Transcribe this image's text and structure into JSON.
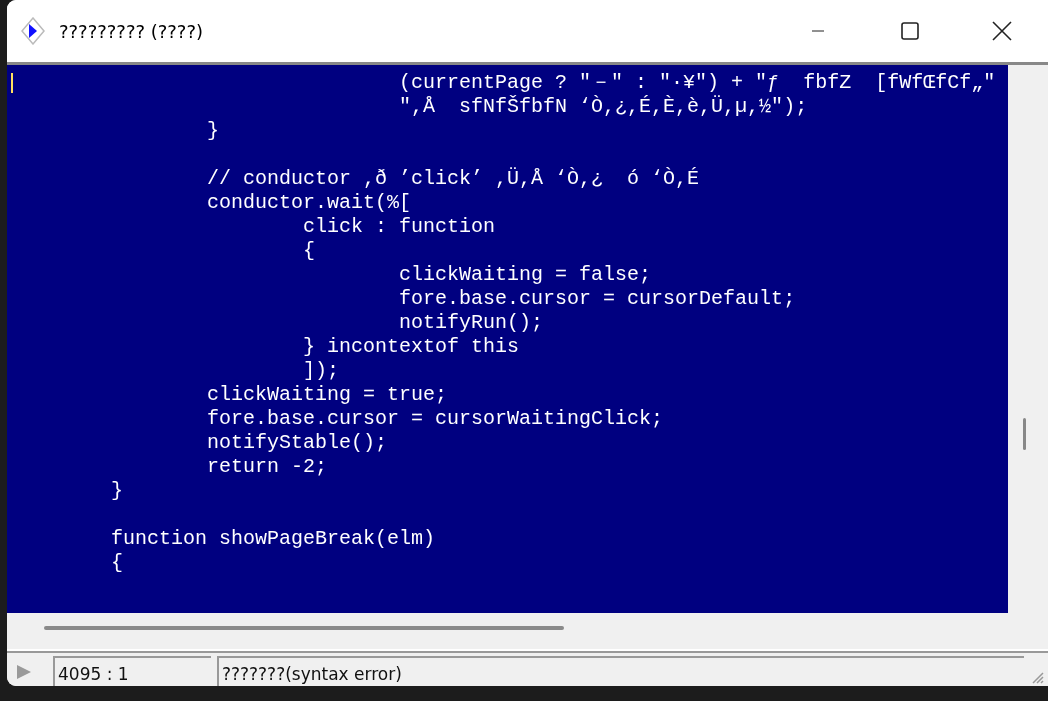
{
  "window": {
    "title": "????????? (????)"
  },
  "editor": {
    "lines": [
      {
        "text": "\t\t\t\t(currentPage ? \"－\" : \"·¥\") + \"ƒ  fbfZ  [fWfŒfCf„\"",
        "blank_before": false
      },
      {
        "text": "\t\t\t\t\",Å  sfNfŠfbfN ‘Ò,¿,É,È,è,Ü,µ,½\");",
        "blank_before": false
      },
      {
        "text": "\t\t}",
        "blank_before": false
      },
      {
        "text": "\t\t// conductor ,ð ’click’ ,Ü,Å ‘Ò,¿  ó ‘Ò,É",
        "blank_before": true
      },
      {
        "text": "\t\tconductor.wait(%[",
        "blank_before": false
      },
      {
        "text": "\t\t\tclick : function",
        "blank_before": false
      },
      {
        "text": "\t\t\t{",
        "blank_before": false
      },
      {
        "text": "\t\t\t\tclickWaiting = false;",
        "blank_before": false
      },
      {
        "text": "\t\t\t\tfore.base.cursor = cursorDefault;",
        "blank_before": false
      },
      {
        "text": "\t\t\t\tnotifyRun();",
        "blank_before": false
      },
      {
        "text": "\t\t\t} incontextof this",
        "blank_before": false
      },
      {
        "text": "\t\t\t]);",
        "blank_before": false
      },
      {
        "text": "\t\tclickWaiting = true;",
        "blank_before": false
      },
      {
        "text": "\t\tfore.base.cursor = cursorWaitingClick;",
        "blank_before": false
      },
      {
        "text": "\t\tnotifyStable();",
        "blank_before": false
      },
      {
        "text": "\t\treturn -2;",
        "blank_before": false
      },
      {
        "text": "\t}",
        "blank_before": false
      },
      {
        "text": "\tfunction showPageBreak(elm)",
        "blank_before": true
      },
      {
        "text": "\t{",
        "blank_before": false
      }
    ]
  },
  "status_bar": {
    "position": "4095 : 1",
    "message": "???????(syntax error)"
  }
}
